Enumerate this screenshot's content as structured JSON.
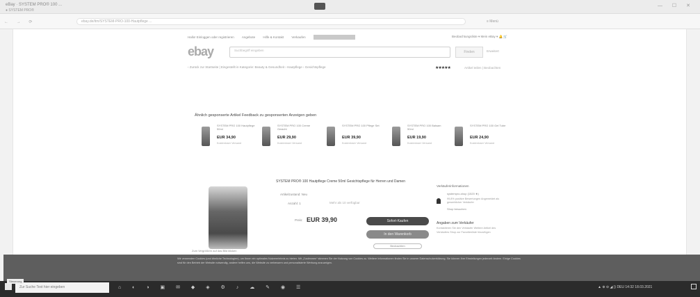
{
  "browser": {
    "tab_title": "eBay · SYSTEM PRO® 100 ...",
    "tab_sub": "● SYSTEM PRO®",
    "url": "ebay.de/itm/SYSTEM-PRO-100-Hautpflege ...",
    "window_controls": "— ☐ ✕",
    "extension_label": "≡ Menü",
    "nav_icons": "← → ⟳"
  },
  "ebay": {
    "logo": "ebay",
    "topnav": [
      "Hallo! Einloggen oder registrieren",
      "Angebote",
      "Hilfe & Kontakt",
      "Verkaufen"
    ],
    "topnav_right": "Beobachtungsliste ▾   Mein eBay ▾   🔔   🛒",
    "search_placeholder": "Suchbegriff eingeben",
    "search_button": "Finden",
    "advanced": "Erweitert",
    "breadcrumb": "‹ Zurück zur Startseite  |  Eingestellt in Kategorie: Beauty & Gesundheit › Hautpflege › Gesichtspflege",
    "stars": "★★★★★",
    "stars_text": "Artikel teilen | Beobachten",
    "section_title": "Ähnlich gesponserte Artikel  Feedback zu gesponserten Anzeigen geben",
    "products": [
      {
        "name": "SYSTEM PRO 100 Hautpflege 50ml",
        "price": "EUR 34,90",
        "ship": "Kostenloser Versand"
      },
      {
        "name": "SYSTEM PRO 100 Creme Gesicht",
        "price": "EUR 29,90",
        "ship": "Kostenloser Versand"
      },
      {
        "name": "SYSTEM PRO 100 Pflege Set",
        "price": "EUR 39,90",
        "ship": "Kostenloser Versand"
      },
      {
        "name": "SYSTEM PRO 100 Balsam 50ml",
        "price": "EUR 19,90",
        "ship": "Kostenloser Versand"
      },
      {
        "name": "SYSTEM PRO 100 Gel Tube",
        "price": "EUR 24,90",
        "ship": "Kostenloser Versand"
      }
    ],
    "main_image_caption": "Zum Vergrößern auf das Bild klicken",
    "desc_title": "SYSTEM PRO® 100 Hautpflege Creme 50ml Gesichtspflege für Herren und Damen",
    "condition_label": "Artikelzustand:  Neu",
    "quantity_label": "Anzahl:  1",
    "quantity_note": "Mehr als 10 verfügbar",
    "price_label": "Preis:",
    "price": "EUR 39,90",
    "buy_button": "Sofort-Kaufen",
    "cart_button": "In den Warenkorb",
    "watch_button": "Beobachten",
    "seller_title": "Verkäuferinformationen",
    "seller_name": "systempro-shop (1520 ★)",
    "seller_info": "99,8% positive Bewertungen  Angemeldet als gewerblicher Verkäufer",
    "seller_link": "Shop besuchen",
    "shop_title": "Angaben zum Verkäufer",
    "shop_lines": "Kontaktieren Sie den Verkäufer  Weitere Artikel des Verkäufers  Shop zur Favoritenliste hinzufügen"
  },
  "cookie": {
    "text": "Wir verwenden Cookies (und ähnliche Technologien), um Ihnen ein optimales Nutzererlebnis zu bieten. Mit „Zustimmen“ stimmen Sie der Nutzung von Cookies zu. Weitere Informationen finden Sie in unserer Datenschutzerklärung. Sie können Ihre Einstellungen jederzeit ändern. Einige Cookies sind für den Betrieb der Website notwendig, andere helfen uns, die Website zu verbessern und personalisierte Werbung anzuzeigen."
  },
  "taskbar": {
    "search_placeholder": "Zur Suche Text hier eingeben",
    "icons": "⌂ ◐ ◑ ▣ ✉ ◆ ◈ ⚙ ♪ ☁ ✎ ◉ ☰",
    "tray": "▲  ⊕ ⊖ ◢ ))  DEU   14:32  18.03.2021",
    "tooltip": "Steuerung"
  }
}
